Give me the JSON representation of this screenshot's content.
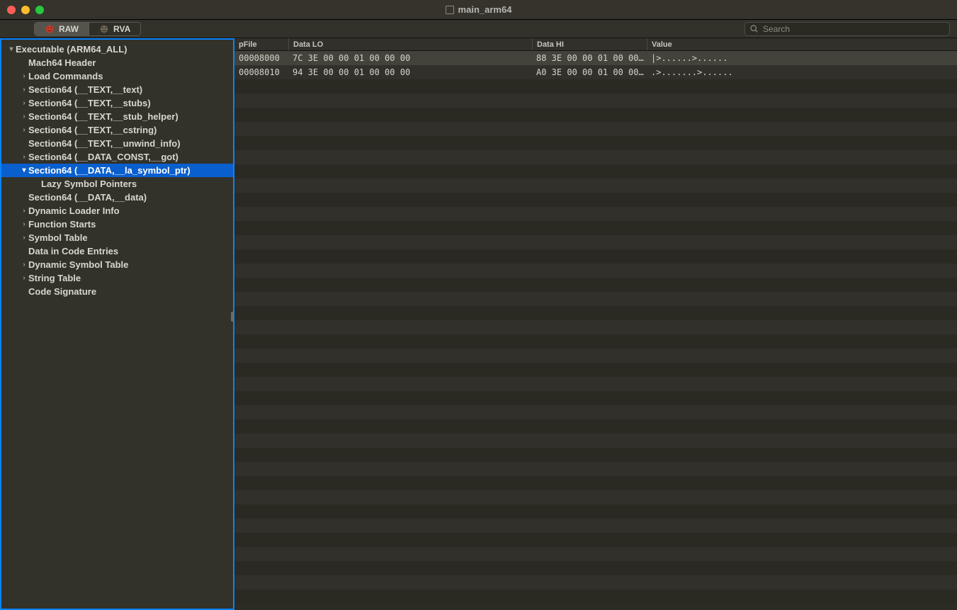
{
  "window": {
    "title": "main_arm64"
  },
  "toolbar": {
    "tabs": [
      {
        "label": "RAW",
        "active": true
      },
      {
        "label": "RVA",
        "active": false
      }
    ],
    "search_placeholder": "Search"
  },
  "tree": [
    {
      "indent": 0,
      "caret": "down",
      "label": "Executable  (ARM64_ALL)"
    },
    {
      "indent": 1,
      "caret": "",
      "label": "Mach64 Header"
    },
    {
      "indent": 1,
      "caret": "right",
      "label": "Load Commands"
    },
    {
      "indent": 1,
      "caret": "right",
      "label": "Section64 (__TEXT,__text)"
    },
    {
      "indent": 1,
      "caret": "right",
      "label": "Section64 (__TEXT,__stubs)"
    },
    {
      "indent": 1,
      "caret": "right",
      "label": "Section64 (__TEXT,__stub_helper)"
    },
    {
      "indent": 1,
      "caret": "right",
      "label": "Section64 (__TEXT,__cstring)"
    },
    {
      "indent": 1,
      "caret": "",
      "label": "Section64 (__TEXT,__unwind_info)"
    },
    {
      "indent": 1,
      "caret": "right",
      "label": "Section64 (__DATA_CONST,__got)"
    },
    {
      "indent": 1,
      "caret": "down",
      "label": "Section64 (__DATA,__la_symbol_ptr)",
      "selected": true
    },
    {
      "indent": 2,
      "caret": "",
      "label": "Lazy Symbol Pointers"
    },
    {
      "indent": 1,
      "caret": "",
      "label": "Section64 (__DATA,__data)"
    },
    {
      "indent": 1,
      "caret": "right",
      "label": "Dynamic Loader Info"
    },
    {
      "indent": 1,
      "caret": "right",
      "label": "Function Starts"
    },
    {
      "indent": 1,
      "caret": "right",
      "label": "Symbol Table"
    },
    {
      "indent": 1,
      "caret": "",
      "label": "Data in Code Entries"
    },
    {
      "indent": 1,
      "caret": "right",
      "label": "Dynamic Symbol Table"
    },
    {
      "indent": 1,
      "caret": "right",
      "label": "String Table"
    },
    {
      "indent": 1,
      "caret": "",
      "label": "Code Signature"
    }
  ],
  "columns": {
    "pfile": "pFile",
    "datalo": "Data LO",
    "datahi": "Data HI",
    "value": "Value"
  },
  "rows": [
    {
      "pfile": "00008000",
      "datalo": "7C 3E 00 00 01 00 00 00",
      "datahi": "88 3E 00 00 01 00 00…",
      "value": "|>......>......",
      "selected": true
    },
    {
      "pfile": "00008010",
      "datalo": "94 3E 00 00 01 00 00 00",
      "datahi": "A0 3E 00 00 01 00 00…",
      "value": ".>.......>......"
    }
  ],
  "empty_rows": 37
}
